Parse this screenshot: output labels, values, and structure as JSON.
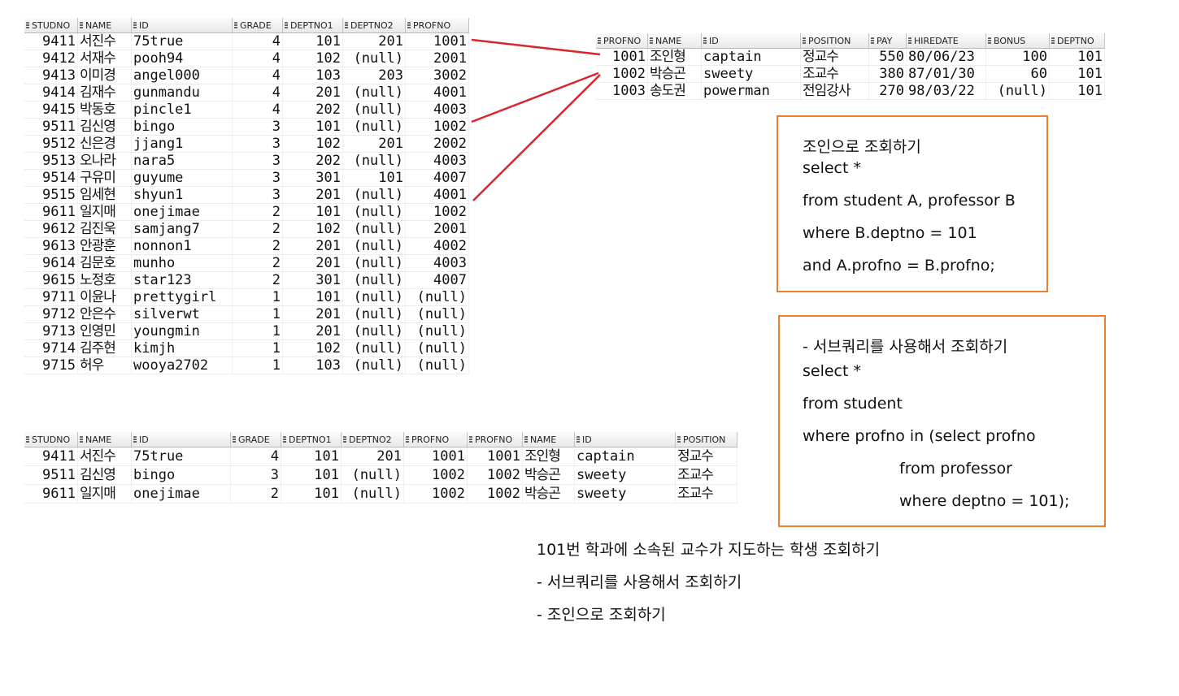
{
  "student_table": {
    "columns": [
      "STUDNO",
      "NAME",
      "ID",
      "GRADE",
      "DEPTNO1",
      "DEPTNO2",
      "PROFNO"
    ],
    "rows": [
      [
        "9411",
        "서진수",
        "75true",
        "4",
        "101",
        "201",
        "1001"
      ],
      [
        "9412",
        "서재수",
        "pooh94",
        "4",
        "102",
        "(null)",
        "2001"
      ],
      [
        "9413",
        "이미경",
        "angel000",
        "4",
        "103",
        "203",
        "3002"
      ],
      [
        "9414",
        "김재수",
        "gunmandu",
        "4",
        "201",
        "(null)",
        "4001"
      ],
      [
        "9415",
        "박동호",
        "pincle1",
        "4",
        "202",
        "(null)",
        "4003"
      ],
      [
        "9511",
        "김신영",
        "bingo",
        "3",
        "101",
        "(null)",
        "1002"
      ],
      [
        "9512",
        "신은경",
        "jjang1",
        "3",
        "102",
        "201",
        "2002"
      ],
      [
        "9513",
        "오나라",
        "nara5",
        "3",
        "202",
        "(null)",
        "4003"
      ],
      [
        "9514",
        "구유미",
        "guyume",
        "3",
        "301",
        "101",
        "4007"
      ],
      [
        "9515",
        "임세현",
        "shyun1",
        "3",
        "201",
        "(null)",
        "4001"
      ],
      [
        "9611",
        "일지매",
        "onejimae",
        "2",
        "101",
        "(null)",
        "1002"
      ],
      [
        "9612",
        "김진욱",
        "samjang7",
        "2",
        "102",
        "(null)",
        "2001"
      ],
      [
        "9613",
        "안광훈",
        "nonnon1",
        "2",
        "201",
        "(null)",
        "4002"
      ],
      [
        "9614",
        "김문호",
        "munho",
        "2",
        "201",
        "(null)",
        "4003"
      ],
      [
        "9615",
        "노정호",
        "star123",
        "2",
        "301",
        "(null)",
        "4007"
      ],
      [
        "9711",
        "이윤나",
        "prettygirl",
        "1",
        "101",
        "(null)",
        "(null)"
      ],
      [
        "9712",
        "안은수",
        "silverwt",
        "1",
        "201",
        "(null)",
        "(null)"
      ],
      [
        "9713",
        "인영민",
        "youngmin",
        "1",
        "201",
        "(null)",
        "(null)"
      ],
      [
        "9714",
        "김주현",
        "kimjh",
        "1",
        "102",
        "(null)",
        "(null)"
      ],
      [
        "9715",
        "허우",
        "wooya2702",
        "1",
        "103",
        "(null)",
        "(null)"
      ]
    ]
  },
  "professor_table": {
    "columns": [
      "PROFNO",
      "NAME",
      "ID",
      "POSITION",
      "PAY",
      "HIREDATE",
      "BONUS",
      "DEPTNO"
    ],
    "rows": [
      [
        "1001",
        "조인형",
        "captain",
        "정교수",
        "550",
        "80/06/23",
        "100",
        "101"
      ],
      [
        "1002",
        "박승곤",
        "sweety",
        "조교수",
        "380",
        "87/01/30",
        "60",
        "101"
      ],
      [
        "1003",
        "송도권",
        "powerman",
        "전임강사",
        "270",
        "98/03/22",
        "(null)",
        "101"
      ]
    ]
  },
  "result_table": {
    "columns": [
      "STUDNO",
      "NAME",
      "ID",
      "GRADE",
      "DEPTNO1",
      "DEPTNO2",
      "PROFNO",
      "PROFNO",
      "NAME",
      "ID",
      "POSITION"
    ],
    "rows": [
      [
        "9411",
        "서진수",
        "75true",
        "4",
        "101",
        "201",
        "1001",
        "1001",
        "조인형",
        "captain",
        "정교수"
      ],
      [
        "9511",
        "김신영",
        "bingo",
        "3",
        "101",
        "(null)",
        "1002",
        "1002",
        "박승곤",
        "sweety",
        "조교수"
      ],
      [
        "9611",
        "일지매",
        "onejimae",
        "2",
        "101",
        "(null)",
        "1002",
        "1002",
        "박승곤",
        "sweety",
        "조교수"
      ]
    ]
  },
  "join_box": {
    "lines": [
      "조인으로 조회하기",
      "select *",
      "from student A, professor B",
      "where B.deptno = 101",
      "and A.profno = B.profno;"
    ]
  },
  "subquery_box": {
    "lines": [
      "- 서브쿼리를 사용해서 조회하기",
      "select *",
      "from student",
      "where profno in (select profno",
      "from professor",
      "where deptno = 101);"
    ]
  },
  "captions": {
    "question": "101번 학과에 소속된 교수가 지도하는 학생 조회하기",
    "subquery": "- 서브쿼리를 사용해서 조회하기",
    "join": "- 조인으로 조회하기"
  },
  "colors": {
    "arrow": "#d9262c",
    "box_border": "#ed7d31"
  }
}
